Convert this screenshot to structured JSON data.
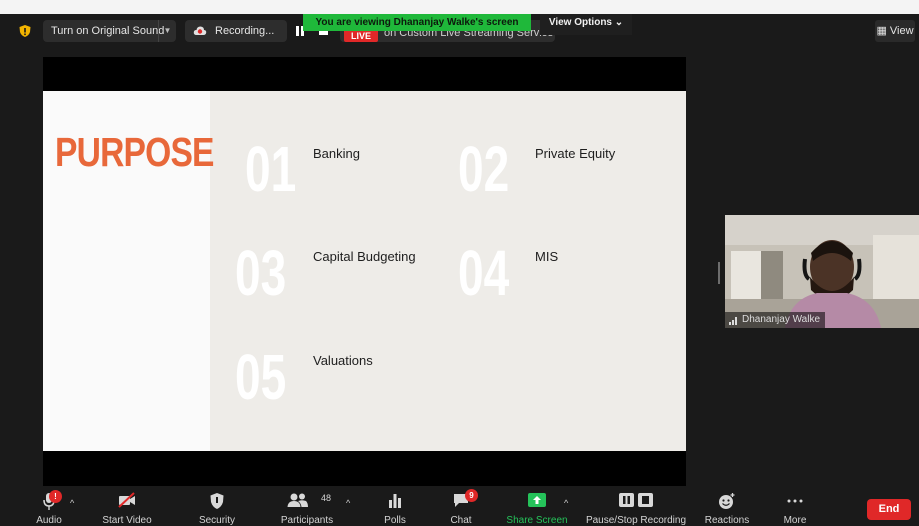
{
  "top_bar": {
    "original_sound": "Turn on Original Sound",
    "recording": "Recording...",
    "live_badge": "LIVE",
    "live_text": "on Custom Live Streaming Service",
    "viewing_banner": "You are viewing Dhananjay Walke's screen",
    "view_options": "View Options",
    "view": "View"
  },
  "slide": {
    "title": "PURPOSE",
    "items": [
      {
        "number": "01",
        "label": "Banking"
      },
      {
        "number": "02",
        "label": "Private Equity"
      },
      {
        "number": "03",
        "label": "Capital Budgeting"
      },
      {
        "number": "04",
        "label": "MIS"
      },
      {
        "number": "05",
        "label": "Valuations"
      }
    ]
  },
  "participant": {
    "name": "Dhananjay Walke"
  },
  "toolbar": {
    "audio": "Audio",
    "start_video": "Start Video",
    "security": "Security",
    "participants": "Participants",
    "participants_count": "48",
    "polls": "Polls",
    "chat": "Chat",
    "chat_badge": "9",
    "audio_badge": "!",
    "share_screen": "Share Screen",
    "pause_stop_recording": "Pause/Stop Recording",
    "reactions": "Reactions",
    "more": "More",
    "end": "End"
  },
  "colors": {
    "accent_orange": "#e8683a",
    "live_red": "#e02828",
    "share_green": "#25c25a",
    "banner_green": "#1fb83a"
  }
}
